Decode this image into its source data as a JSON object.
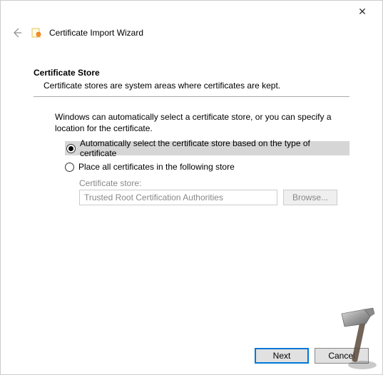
{
  "window": {
    "title": "Certificate Import Wizard"
  },
  "section": {
    "heading": "Certificate Store",
    "description": "Certificate stores are system areas where certificates are kept."
  },
  "body": {
    "intro": "Windows can automatically select a certificate store, or you can specify a location for the certificate."
  },
  "options": {
    "auto": "Automatically select the certificate store based on the type of certificate",
    "manual": "Place all certificates in the following store"
  },
  "store": {
    "label": "Certificate store:",
    "value": "Trusted Root Certification Authorities",
    "browse": "Browse..."
  },
  "footer": {
    "next": "Next",
    "cancel": "Cancel"
  }
}
